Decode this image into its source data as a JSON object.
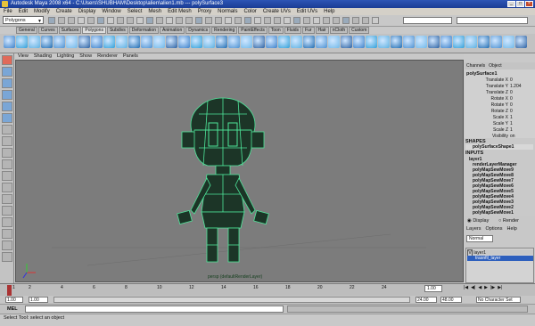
{
  "window": {
    "title": "Autodesk Maya 2008 x64 - C:\\Users\\SHUBHAM\\Desktop\\alien\\alien1.mb  ---  polySurface3"
  },
  "menubar": {
    "items": [
      "File",
      "Edit",
      "Modify",
      "Create",
      "Display",
      "Window",
      "Select",
      "Mesh",
      "Edit Mesh",
      "Proxy",
      "Normals",
      "Color",
      "Create UVs",
      "Edit UVs",
      "Help"
    ]
  },
  "statusline": {
    "mode": "Polygons"
  },
  "shelf_tabs": [
    "General",
    "Curves",
    "Surfaces",
    "Polygons",
    "Subdivs",
    "Deformation",
    "Animation",
    "Dynamics",
    "Rendering",
    "PaintEffects",
    "Toon",
    "Fluids",
    "Fur",
    "Hair",
    "nCloth",
    "Custom"
  ],
  "shelf_active_tab": "Polygons",
  "panel_menu": [
    "View",
    "Shading",
    "Lighting",
    "Show",
    "Renderer",
    "Panels"
  ],
  "viewport": {
    "layer_label": "persp (defaultRenderLayer)",
    "background": "#7c7c7c",
    "wire_color": "#4ee69a"
  },
  "channel_box": {
    "tabs": [
      "Channels",
      "Object"
    ],
    "object_name": "polySurface1",
    "attributes": [
      {
        "name": "Translate X",
        "value": "0"
      },
      {
        "name": "Translate Y",
        "value": "1.204"
      },
      {
        "name": "Translate Z",
        "value": "0"
      },
      {
        "name": "Rotate X",
        "value": "0"
      },
      {
        "name": "Rotate Y",
        "value": "0"
      },
      {
        "name": "Rotate Z",
        "value": "0"
      },
      {
        "name": "Scale X",
        "value": "1"
      },
      {
        "name": "Scale Y",
        "value": "1"
      },
      {
        "name": "Scale Z",
        "value": "1"
      },
      {
        "name": "Visibility",
        "value": "on"
      }
    ],
    "shapes_header": "SHAPES",
    "shape_name": "polySurfaceShape1",
    "inputs_header": "INPUTS",
    "inputs": [
      "layer1",
      "renderLayerManager",
      "polyMapSewMove9",
      "polyMapSewMove8",
      "polyMapSewMove7",
      "polyMapSewMove6",
      "polyMapSewMove5",
      "polyMapSewMove4",
      "polyMapSewMove3",
      "polyMapSewMove2",
      "polyMapSewMove1"
    ]
  },
  "layer_editor": {
    "display_label": "Display",
    "render_label": "Render",
    "menu": [
      "Layers",
      "Options",
      "Help"
    ],
    "dropdown": "Normal",
    "layers": [
      {
        "v": "V",
        "name": "layer1"
      },
      {
        "v": "",
        "name": "trasnfil_layer"
      }
    ]
  },
  "timeline": {
    "ticks": [
      "1",
      "2",
      "4",
      "6",
      "8",
      "10",
      "12",
      "14",
      "16",
      "18",
      "20",
      "22",
      "24"
    ],
    "current_frame": "1.00"
  },
  "range": {
    "start": "1.00",
    "range_start": "1.00",
    "range_end": "24.00",
    "end": "48.00",
    "character_set": "No Character Set"
  },
  "mel": {
    "label": "MEL"
  },
  "helpline": {
    "text": "Select Tool: select an object"
  }
}
